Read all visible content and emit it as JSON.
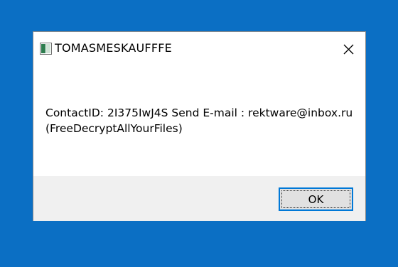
{
  "dialog": {
    "title": "TOMASMESKAUFFFE",
    "icon": "app-window-icon",
    "close_icon": "close-icon",
    "message_line1": "ContactID: 2I375IwJ4S Send E-mail : rektware@inbox.ru",
    "message_line2": "(FreeDecryptAllYourFiles)",
    "ok_label": "OK"
  },
  "colors": {
    "desktop_background": "#0b6fc4",
    "dialog_background": "#ffffff",
    "footer_background": "#f0f0f0",
    "button_focus_border": "#0078d7"
  }
}
